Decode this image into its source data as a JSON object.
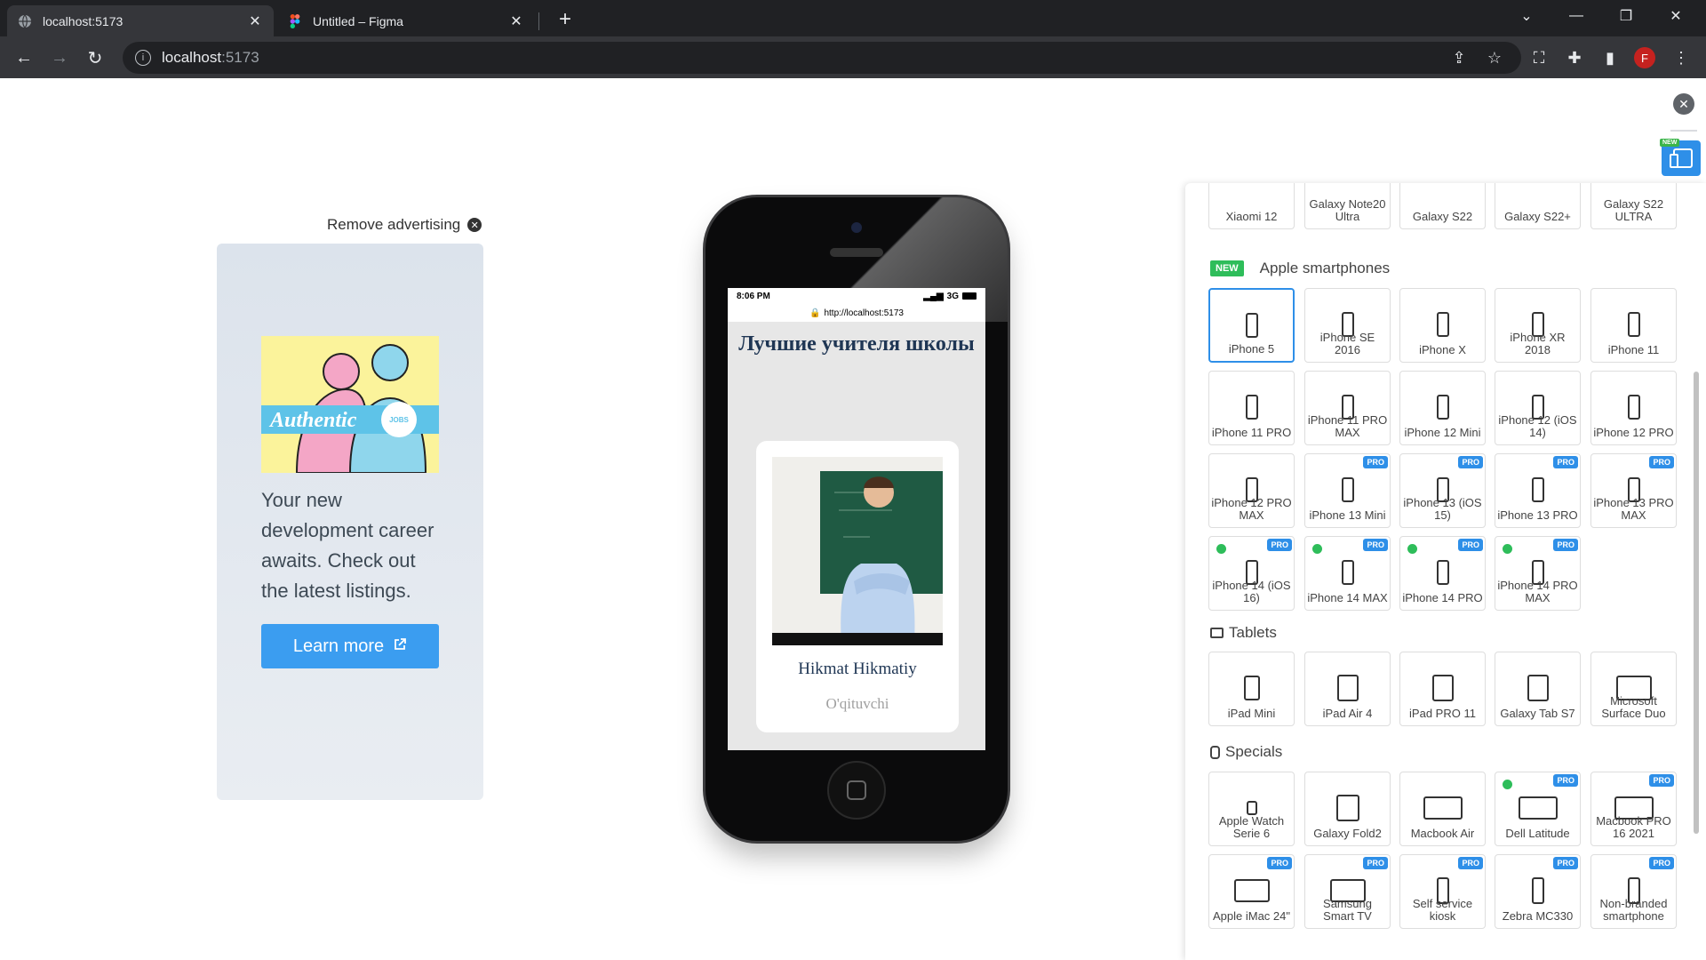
{
  "browser": {
    "tabs": [
      {
        "title": "localhost:5173",
        "active": true
      },
      {
        "title": "Untitled – Figma",
        "active": false
      }
    ],
    "url_host": "localhost",
    "url_port": ":5173"
  },
  "ad": {
    "remove_label": "Remove advertising",
    "logo_text": "Authentic",
    "logo_badge": "JOBS",
    "text": "Your new development career awaits. Check out the latest listings.",
    "button_label": "Learn more"
  },
  "phone": {
    "time": "8:06 PM",
    "network": "3G",
    "url": "http://localhost:5173",
    "page_title": "Лучшие учителя школы",
    "card_name": "Hikmat Hikmatiy",
    "card_role": "O'qituvchi"
  },
  "panel": {
    "new_badge": "NEW",
    "pro_badge": "PRO",
    "partial_row": [
      "Xiaomi 12",
      "Galaxy Note20 Ultra",
      "Galaxy S22",
      "Galaxy S22+",
      "Galaxy S22 ULTRA"
    ],
    "apple_title": "Apple smartphones",
    "apple": [
      {
        "label": "iPhone 5",
        "selected": true,
        "pro": false,
        "dot": false
      },
      {
        "label": "iPhone SE 2016",
        "selected": false,
        "pro": false,
        "dot": false
      },
      {
        "label": "iPhone X",
        "selected": false,
        "pro": false,
        "dot": false
      },
      {
        "label": "iPhone XR 2018",
        "selected": false,
        "pro": false,
        "dot": false
      },
      {
        "label": "iPhone 11",
        "selected": false,
        "pro": false,
        "dot": false
      },
      {
        "label": "iPhone 11 PRO",
        "selected": false,
        "pro": false,
        "dot": false
      },
      {
        "label": "iPhone 11 PRO MAX",
        "selected": false,
        "pro": false,
        "dot": false
      },
      {
        "label": "iPhone 12 Mini",
        "selected": false,
        "pro": false,
        "dot": false
      },
      {
        "label": "iPhone 12 (iOS 14)",
        "selected": false,
        "pro": false,
        "dot": false
      },
      {
        "label": "iPhone 12 PRO",
        "selected": false,
        "pro": false,
        "dot": false
      },
      {
        "label": "iPhone 12 PRO MAX",
        "selected": false,
        "pro": false,
        "dot": false
      },
      {
        "label": "iPhone 13 Mini",
        "selected": false,
        "pro": true,
        "dot": false
      },
      {
        "label": "iPhone 13 (iOS 15)",
        "selected": false,
        "pro": true,
        "dot": false
      },
      {
        "label": "iPhone 13 PRO",
        "selected": false,
        "pro": true,
        "dot": false
      },
      {
        "label": "iPhone 13 PRO MAX",
        "selected": false,
        "pro": true,
        "dot": false
      },
      {
        "label": "iPhone 14 (iOS 16)",
        "selected": false,
        "pro": true,
        "dot": true
      },
      {
        "label": "iPhone 14 MAX",
        "selected": false,
        "pro": true,
        "dot": true
      },
      {
        "label": "iPhone 14 PRO",
        "selected": false,
        "pro": true,
        "dot": true
      },
      {
        "label": "iPhone 14 PRO MAX",
        "selected": false,
        "pro": true,
        "dot": true
      }
    ],
    "tablets_title": "Tablets",
    "tablets": [
      {
        "label": "iPad Mini",
        "pro": false,
        "dot": false
      },
      {
        "label": "iPad Air 4",
        "pro": false,
        "dot": false
      },
      {
        "label": "iPad PRO 11",
        "pro": false,
        "dot": false
      },
      {
        "label": "Galaxy Tab S7",
        "pro": false,
        "dot": false
      },
      {
        "label": "Microsoft Surface Duo",
        "pro": false,
        "dot": false
      }
    ],
    "specials_title": "Specials",
    "specials": [
      {
        "label": "Apple Watch Serie 6",
        "pro": false,
        "dot": false
      },
      {
        "label": "Galaxy Fold2",
        "pro": false,
        "dot": false
      },
      {
        "label": "Macbook Air",
        "pro": false,
        "dot": false
      },
      {
        "label": "Dell Latitude",
        "pro": true,
        "dot": true
      },
      {
        "label": "Macbook PRO 16 2021",
        "pro": true,
        "dot": false
      },
      {
        "label": "Apple iMac 24\"",
        "pro": true,
        "dot": false
      },
      {
        "label": "Samsung Smart TV",
        "pro": true,
        "dot": false
      },
      {
        "label": "Self service kiosk",
        "pro": true,
        "dot": false
      },
      {
        "label": "Zebra MC330",
        "pro": true,
        "dot": false
      },
      {
        "label": "Non-branded smartphone",
        "pro": true,
        "dot": false
      }
    ]
  }
}
